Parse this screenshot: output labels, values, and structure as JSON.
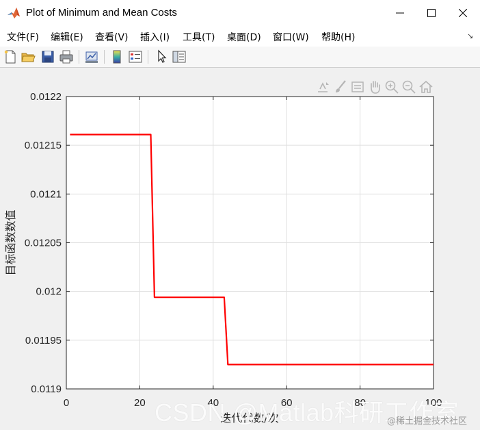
{
  "window": {
    "title": "Plot of Minimum and Mean Costs",
    "controls": [
      "minimize-icon",
      "maximize-icon",
      "close-icon"
    ]
  },
  "menubar": {
    "items": [
      {
        "label": "文件(F)"
      },
      {
        "label": "编辑(E)"
      },
      {
        "label": "查看(V)"
      },
      {
        "label": "插入(I)"
      },
      {
        "label": "工具(T)"
      },
      {
        "label": "桌面(D)"
      },
      {
        "label": "窗口(W)"
      },
      {
        "label": "帮助(H)"
      }
    ],
    "dock_arrow": "↘"
  },
  "toolbar": {
    "buttons": [
      "new-figure-icon",
      "open-file-icon",
      "save-icon",
      "print-icon",
      "link-plot-icon",
      "insert-colorbar-icon",
      "insert-legend-icon",
      "edit-plot-arrow-icon",
      "property-inspector-icon"
    ]
  },
  "axes_toolbar": {
    "buttons": [
      "export-icon",
      "brush-icon",
      "data-tips-icon",
      "pan-icon",
      "zoom-in-icon",
      "zoom-out-icon",
      "home-icon"
    ]
  },
  "chart_data": {
    "type": "line",
    "title": "",
    "xlabel": "迭代代数/次",
    "ylabel": "目标函数数值",
    "xlim": [
      0,
      100
    ],
    "ylim": [
      0.0119,
      0.0122
    ],
    "xticks": [
      0,
      20,
      40,
      60,
      80,
      100
    ],
    "xtick_labels": [
      "0",
      "20",
      "40",
      "60",
      "80",
      "100"
    ],
    "yticks": [
      0.0119,
      0.01195,
      0.012,
      0.01205,
      0.0121,
      0.01215,
      0.0122
    ],
    "ytick_labels": [
      "0.0119",
      "0.01195",
      "0.012",
      "0.01205",
      "0.0121",
      "0.01215",
      "0.0122"
    ],
    "grid": true,
    "series": [
      {
        "color": "#ff0000",
        "x": [
          1,
          23,
          24,
          43,
          44,
          100
        ],
        "y": [
          0.012161,
          0.012161,
          0.011994,
          0.011994,
          0.011925,
          0.011925
        ]
      }
    ]
  },
  "watermark": {
    "text": "CSDN @Matlab科研工作室",
    "text2": "@稀土掘金技术社区"
  }
}
